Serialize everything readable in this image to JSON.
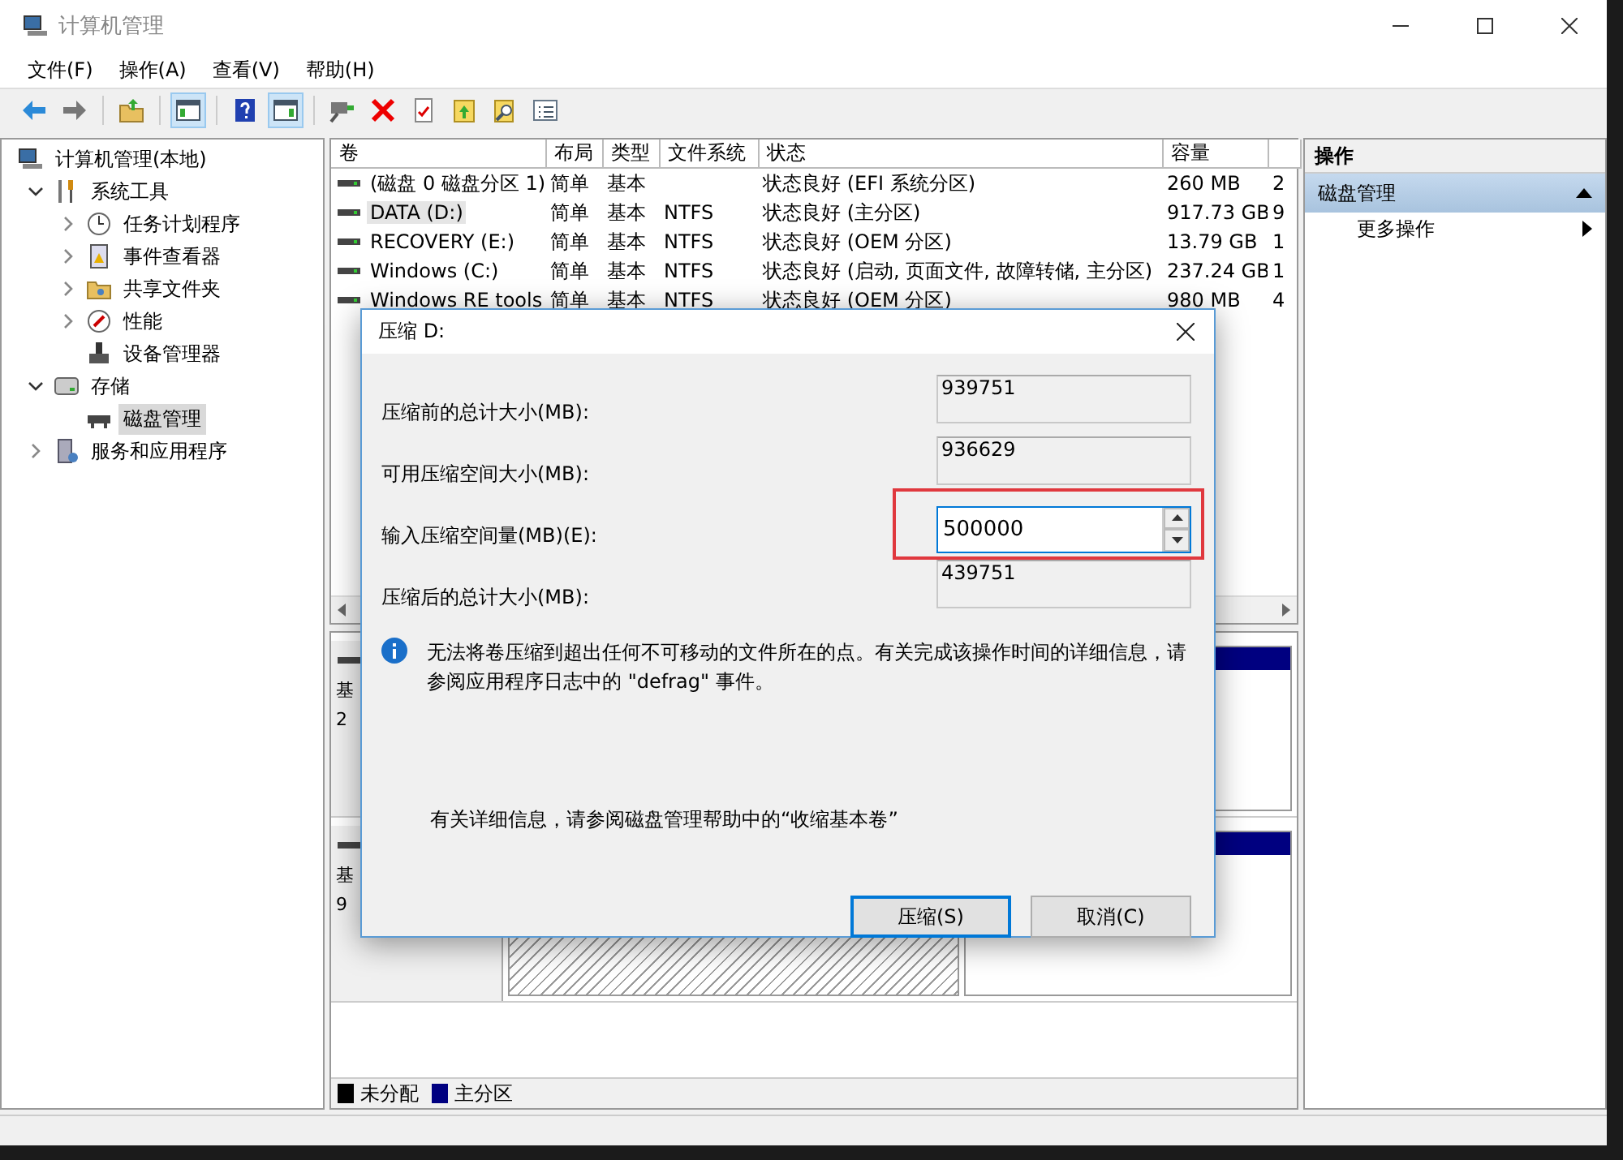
{
  "window": {
    "title": "计算机管理"
  },
  "menu": [
    "文件(F)",
    "操作(A)",
    "查看(V)",
    "帮助(H)"
  ],
  "toolbar": [
    {
      "pressed": false
    },
    {
      "pressed": false
    },
    {
      "pressed": false
    },
    {
      "pressed": true
    },
    {
      "pressed": false
    },
    {
      "pressed": true
    },
    {
      "pressed": false
    },
    {
      "pressed": false
    },
    {
      "pressed": false
    },
    {
      "pressed": false
    },
    {
      "pressed": false
    },
    {
      "pressed": false
    }
  ],
  "tree": [
    {
      "label": "计算机管理(本地)",
      "kind": "root",
      "selected": false,
      "children": [
        {
          "label": "系统工具",
          "kind": "node",
          "expanded": true,
          "selected": false,
          "children": [
            {
              "label": "任务计划程序",
              "kind": "node",
              "expanded": false,
              "selected": false
            },
            {
              "label": "事件查看器",
              "kind": "node",
              "expanded": false,
              "selected": false
            },
            {
              "label": "共享文件夹",
              "kind": "node",
              "expanded": false,
              "selected": false
            },
            {
              "label": "性能",
              "kind": "node",
              "expanded": false,
              "selected": false
            },
            {
              "label": "设备管理器",
              "kind": "leaf",
              "selected": false
            }
          ]
        },
        {
          "label": "存储",
          "kind": "node",
          "expanded": true,
          "selected": false,
          "children": [
            {
              "label": "磁盘管理",
              "kind": "leaf",
              "selected": true
            }
          ]
        },
        {
          "label": "服务和应用程序",
          "kind": "node",
          "expanded": false,
          "selected": false
        }
      ]
    }
  ],
  "table": {
    "columns": [
      "卷",
      "布局",
      "类型",
      "文件系统",
      "状态",
      "容量",
      ""
    ],
    "rows": [
      {
        "cells": [
          "(磁盘 0 磁盘分区 1)",
          "简单",
          "基本",
          "",
          "状态良好 (EFI 系统分区)",
          "260 MB",
          "2"
        ],
        "selected": false
      },
      {
        "cells": [
          "DATA (D:)",
          "简单",
          "基本",
          "NTFS",
          "状态良好 (主分区)",
          "917.73 GB",
          "9"
        ],
        "selected": true
      },
      {
        "cells": [
          "RECOVERY (E:)",
          "简单",
          "基本",
          "NTFS",
          "状态良好 (OEM 分区)",
          "13.79 GB",
          "1"
        ],
        "selected": false
      },
      {
        "cells": [
          "Windows (C:)",
          "简单",
          "基本",
          "NTFS",
          "状态良好 (启动, 页面文件, 故障转储, 主分区)",
          "237.24 GB",
          "1"
        ],
        "selected": false
      },
      {
        "cells": [
          "Windows RE tools",
          "简单",
          "基本",
          "NTFS",
          "状态良好 (OEM 分区)",
          "980 MB",
          "4"
        ],
        "selected": false
      }
    ]
  },
  "disks": [
    {
      "lines": [
        "基",
        "2"
      ]
    },
    {
      "lines": [
        "基",
        "9"
      ]
    }
  ],
  "legend": [
    {
      "label": "未分配",
      "color": "#000000"
    },
    {
      "label": "主分区",
      "color": "#000080"
    }
  ],
  "actions": {
    "header": "操作",
    "section": {
      "label": "磁盘管理",
      "expanded": true
    },
    "items": [
      "更多操作"
    ]
  },
  "dialog": {
    "title": "压缩 D:",
    "fields": [
      {
        "label": "压缩前的总计大小(MB):",
        "value": "939751",
        "kind": "readonly"
      },
      {
        "label": "可用压缩空间大小(MB):",
        "value": "936629",
        "kind": "readonly"
      },
      {
        "label": "输入压缩空间量(MB)(E):",
        "value": "500000",
        "kind": "spin",
        "highlighted": true
      },
      {
        "label": "压缩后的总计大小(MB):",
        "value": "439751",
        "kind": "readonly"
      }
    ],
    "info": "无法将卷压缩到超出任何不可移动的文件所在的点。有关完成该操作时间的详细信息，请参阅应用程序日志中的 \"defrag\" 事件。",
    "help": "有关详细信息，请参阅磁盘管理帮助中的“收缩基本卷”",
    "buttons": [
      {
        "label": "压缩(S)",
        "default": true
      },
      {
        "label": "取消(C)",
        "default": false
      }
    ]
  }
}
